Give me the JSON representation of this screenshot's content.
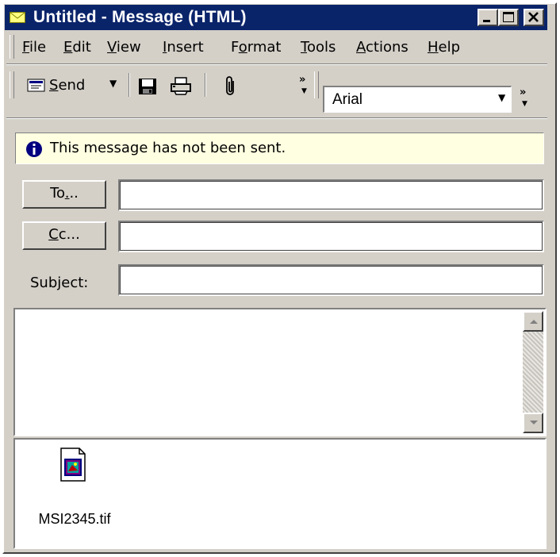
{
  "window": {
    "title": "Untitled - Message (HTML)"
  },
  "menu": [
    {
      "label": "File",
      "accel": "F",
      "rest": "ile"
    },
    {
      "label": "Edit",
      "accel": "E",
      "rest": "dit"
    },
    {
      "label": "View",
      "accel": "V",
      "rest": "iew"
    },
    {
      "label": "Insert",
      "accel": "I",
      "rest": "nsert"
    },
    {
      "label": "Format",
      "pre": "F",
      "accel": "o",
      "rest": "rmat"
    },
    {
      "label": "Tools",
      "accel": "T",
      "rest": "ools"
    },
    {
      "label": "Actions",
      "accel": "A",
      "rest": "ctions"
    },
    {
      "label": "Help",
      "accel": "H",
      "rest": "elp"
    }
  ],
  "toolbar": {
    "send_accel": "S",
    "send_rest": "end",
    "font_name": "Arial",
    "icons": [
      "send-icon",
      "save-icon",
      "print-icon",
      "paperclip-icon"
    ]
  },
  "info": {
    "message": "This message has not been sent."
  },
  "fields": {
    "to_pre": "To",
    "to_accel": ".",
    "to_post": "..",
    "cc_accel": "C",
    "cc_rest": "c...",
    "subject_pre": "Sub",
    "subject_accel": "j",
    "subject_post": "ect:",
    "to_value": "",
    "cc_value": "",
    "subject_value": ""
  },
  "attachments": [
    {
      "name": "MSI2345.tif",
      "icon": "tif-file-icon"
    }
  ],
  "colors": {
    "title_bar": "#0a246a",
    "chrome": "#d4d0c8",
    "info_bg": "#ffffe1"
  }
}
